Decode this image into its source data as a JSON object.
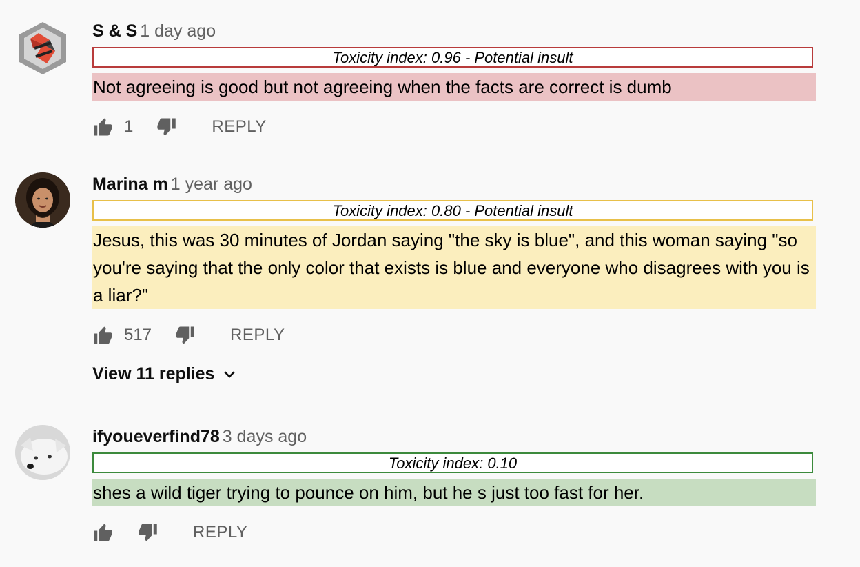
{
  "colors": {
    "high_border": "#b83b3b",
    "high_bg": "#ebc2c4",
    "mid_border": "#e8c04a",
    "mid_bg": "#fbeebe",
    "low_border": "#3c8a3c",
    "low_bg": "#c7ddc1"
  },
  "comments": [
    {
      "author": "S & S",
      "time": "1 day ago",
      "toxicity": "Toxicity index: 0.96 - Potential insult",
      "text": "Not agreeing is good but not agreeing when the facts are correct is dumb",
      "likes": "1",
      "reply_label": "REPLY",
      "avatar_icon": "ss-logo-avatar"
    },
    {
      "author": "Marina m",
      "time": "1 year ago",
      "toxicity": "Toxicity index: 0.80 - Potential insult",
      "text": "Jesus, this was 30 minutes of Jordan saying \"the sky is blue\", and this woman saying \"so you're saying that the only color that exists is blue and everyone who disagrees with you is a liar?\"",
      "likes": "517",
      "reply_label": "REPLY",
      "view_replies": "View 11 replies",
      "avatar_icon": "person-photo-avatar"
    },
    {
      "author": "ifyoueverfind78",
      "time": "3 days ago",
      "toxicity": "Toxicity index: 0.10",
      "text": "shes a wild tiger trying to pounce on him, but he s just too fast for her.",
      "likes": "",
      "reply_label": "REPLY",
      "avatar_icon": "dog-photo-avatar"
    }
  ]
}
